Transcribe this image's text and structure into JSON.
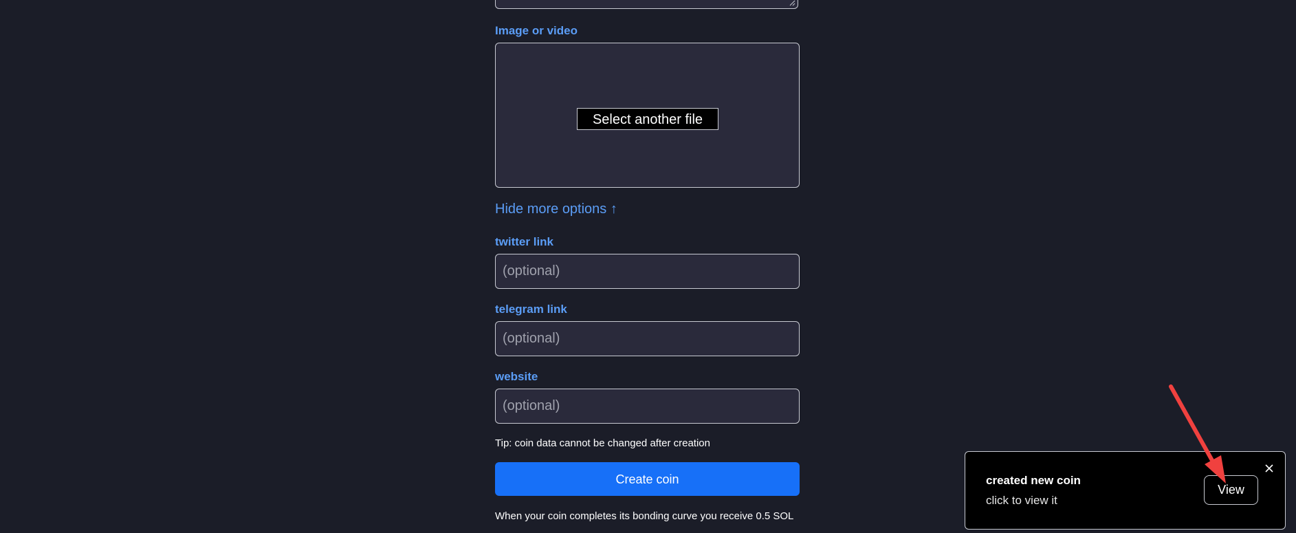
{
  "form": {
    "media_label": "Image or video",
    "file_button_label": "Select another file",
    "more_options_label": "Hide more options ↑",
    "twitter_label": "twitter link",
    "twitter_placeholder": "(optional)",
    "telegram_label": "telegram link",
    "telegram_placeholder": "(optional)",
    "website_label": "website",
    "website_placeholder": "(optional)",
    "tip": "Tip: coin data cannot be changed after creation",
    "create_button_label": "Create coin",
    "bonding_note": "When your coin completes its bonding curve you receive 0.5 SOL"
  },
  "toast": {
    "title": "created new coin",
    "subtitle": "click to view it",
    "view_label": "View"
  },
  "colors": {
    "background": "#1b1d28",
    "field_background": "#2a2a3b",
    "label_blue": "#5b9df6",
    "primary_button": "#1770f8",
    "annotation_arrow": "#f0413f"
  }
}
